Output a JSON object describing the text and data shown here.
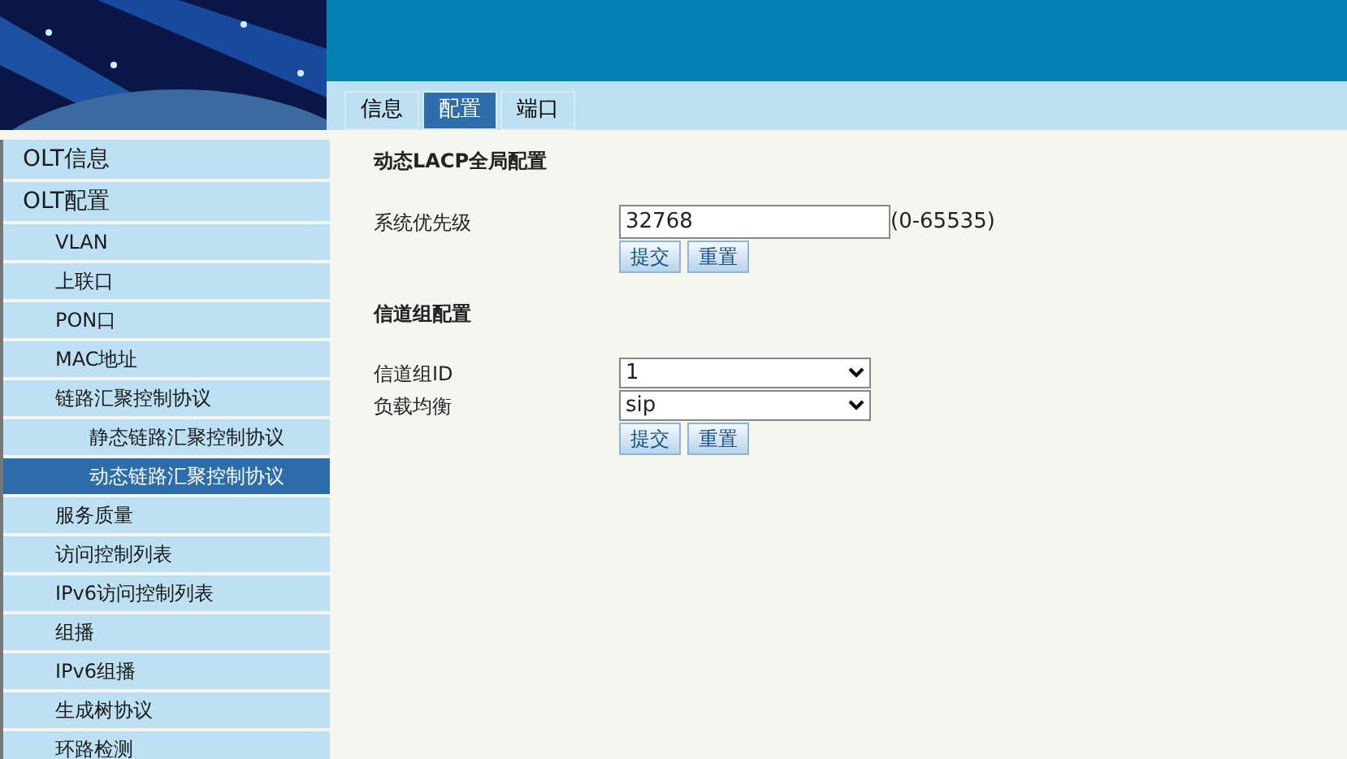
{
  "tabs": [
    {
      "label": "信息",
      "selected": false
    },
    {
      "label": "配置",
      "selected": true
    },
    {
      "label": "端口",
      "selected": false
    }
  ],
  "sidebar": {
    "items": [
      {
        "label": "OLT信息",
        "selected": false
      },
      {
        "label": "OLT配置",
        "selected": false,
        "children": [
          {
            "label": "VLAN",
            "selected": false
          },
          {
            "label": "上联口",
            "selected": false
          },
          {
            "label": "PON口",
            "selected": false
          },
          {
            "label": "MAC地址",
            "selected": false
          },
          {
            "label": "链路汇聚控制协议",
            "selected": false,
            "children": [
              {
                "label": "静态链路汇聚控制协议",
                "selected": false
              },
              {
                "label": "动态链路汇聚控制协议",
                "selected": true
              }
            ]
          },
          {
            "label": "服务质量",
            "selected": false
          },
          {
            "label": "访问控制列表",
            "selected": false
          },
          {
            "label": "IPv6访问控制列表",
            "selected": false
          },
          {
            "label": "组播",
            "selected": false
          },
          {
            "label": "IPv6组播",
            "selected": false
          },
          {
            "label": "生成树协议",
            "selected": false
          },
          {
            "label": "环路检测",
            "selected": false
          }
        ]
      }
    ]
  },
  "sections": [
    {
      "title": "动态LACP全局配置",
      "fields": [
        {
          "kind": "text",
          "label": "系统优先级",
          "value": "32768",
          "hint": "(0-65535)"
        }
      ],
      "buttons": [
        "提交",
        "重置"
      ]
    },
    {
      "title": "信道组配置",
      "fields": [
        {
          "kind": "select",
          "label": "信道组ID",
          "value": "1"
        },
        {
          "kind": "select",
          "label": "负载均衡",
          "value": "sip"
        }
      ],
      "buttons": [
        "提交",
        "重置"
      ]
    }
  ]
}
